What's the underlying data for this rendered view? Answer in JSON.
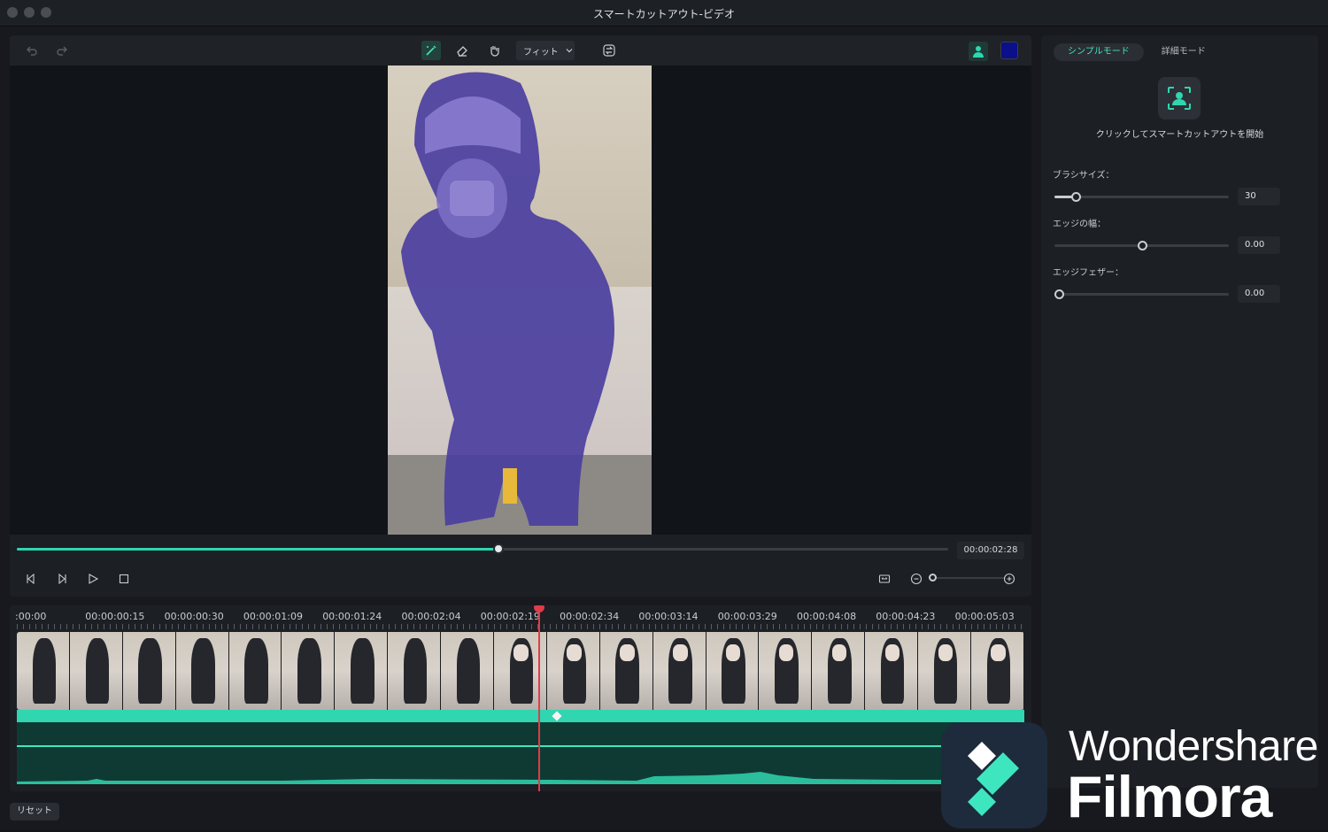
{
  "window": {
    "title": "スマートカットアウト-ビデオ"
  },
  "toolbar": {
    "fit_label": "フィット",
    "icons": [
      "undo-icon",
      "redo-icon",
      "brush-icon",
      "eraser-icon",
      "hand-icon",
      "chevron-down-icon",
      "swap-icon",
      "person-icon"
    ],
    "mask_color": "#0b0f8a"
  },
  "player": {
    "current_time": "00:00:02:28",
    "progress_fraction": 0.52
  },
  "timeline": {
    "ruler_labels": [
      ":00:00",
      "00:00:00:15",
      "00:00:00:30",
      "00:00:01:09",
      "00:00:01:24",
      "00:00:02:04",
      "00:00:02:19",
      "00:00:02:34",
      "00:00:03:14",
      "00:00:03:29",
      "00:00:04:08",
      "00:00:04:23",
      "00:00:05:03"
    ],
    "thumbnail_count": 19
  },
  "footer": {
    "reset_label": "リセット"
  },
  "panel": {
    "tabs": [
      "シンプルモード",
      "詳細モード"
    ],
    "smart_cutout_label": "クリックしてスマートカットアウトを開始",
    "brush_size": {
      "label": "ブラシサイズ：",
      "value": "30",
      "fraction": 0.12
    },
    "edge_width": {
      "label": "エッジの幅：",
      "value": "0.00",
      "fraction": 0.5
    },
    "edge_feather": {
      "label": "エッジフェザー：",
      "value": "0.00",
      "fraction": 0.0
    }
  },
  "watermark": {
    "brand_line1": "Wondershare",
    "brand_line2": "Filmora"
  },
  "colors": {
    "accent": "#2fd6b0",
    "playhead": "#e23b4a",
    "mask": "#4b3fa0"
  }
}
